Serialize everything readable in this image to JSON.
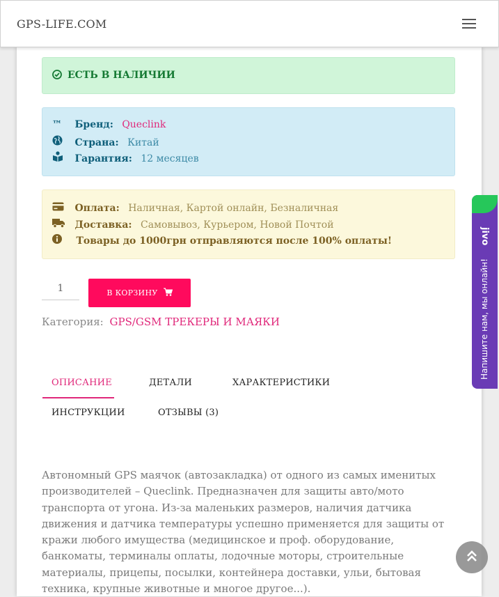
{
  "header": {
    "logo": "GPS-LIFE.COM",
    "menu_icon": "hamburger-icon"
  },
  "stock": {
    "icon": "check-circle-icon",
    "text": "ЕСТЬ В НАЛИЧИИ"
  },
  "info": {
    "brand": {
      "icon": "™",
      "label": "Бренд:",
      "value": "Queclink"
    },
    "country": {
      "icon": "globe-icon",
      "label": "Страна:",
      "value": "Китай"
    },
    "warranty": {
      "icon": "book-reader-icon",
      "label": "Гарантия:",
      "value": "12 месяцев"
    }
  },
  "payment": {
    "pay": {
      "icon": "credit-card-icon",
      "label": "Оплата:",
      "value": "Наличная, Картой онлайн, Безналичная"
    },
    "delivery": {
      "icon": "truck-icon",
      "label": "Доставка:",
      "value": "Самовывоз, Курьером, Новой Почтой"
    },
    "notice": {
      "icon": "info-circle-icon",
      "text": "Товары до 1000грн отправляются после 100% оплаты!"
    }
  },
  "purchase": {
    "quantity": "1",
    "cart_label": "В КОРЗИНУ",
    "cart_icon": "shopping-cart-icon"
  },
  "category": {
    "label": "Категория:",
    "value": "GPS/GSM ТРЕКЕРЫ И МАЯКИ"
  },
  "tabs": [
    {
      "label": "ОПИСАНИЕ",
      "active": true
    },
    {
      "label": "ДЕТАЛИ"
    },
    {
      "label": "ХАРАКТЕРИСТИКИ"
    },
    {
      "label": "ИНСТРУКЦИИ"
    },
    {
      "label": "ОТЗЫВЫ (3)"
    }
  ],
  "description": "Автономный GPS маячок (автозакладка) от одного из самых именитых производителей – Queclink. Предназначен для защиты авто/мото транспорта от угона. Из-за маленьких размеров, наличия датчика движения и датчика температуры успешно применяется для защиты от кражи любого имущества (медицинское и проф. оборудование, банкоматы, терминалы оплаты, лодочные моторы, строительные материалы, прицепы, посылки, контейнера доставки, ульи, бытовая техника, крупные животные и многое другое...).",
  "chat": {
    "logo": "jivo",
    "text": "Напишите нам, мы онлайн!"
  },
  "scroll_top_icon": "double-chevron-up-icon",
  "colors": {
    "accent": "#ff0a5d",
    "link": "#e0287a",
    "success_bg": "#d0f5d9",
    "info_bg": "#d2ecf6",
    "warning_bg": "#fcf8dc",
    "chat": "#6a3bb5"
  }
}
